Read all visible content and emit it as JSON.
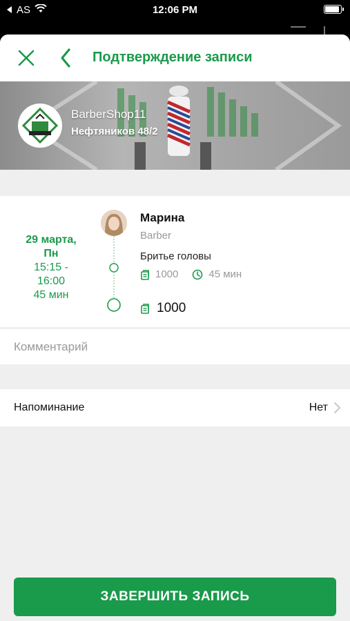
{
  "status_bar": {
    "carrier": "AS",
    "time": "12:06 PM"
  },
  "header": {
    "title": "Подтверждение записи",
    "close_icon": "close-icon",
    "back_icon": "chevron-left-icon"
  },
  "salon": {
    "name": "BarberShop11",
    "address": "Нефтяников 48/2"
  },
  "booking": {
    "date": "29 марта, Пн",
    "time": "15:15 - 16:00",
    "duration": "45 мин",
    "master_name": "Марина",
    "master_role": "Barber",
    "service_name": "Бритье головы",
    "service_price": "1000",
    "service_duration": "45 мин",
    "total": "1000"
  },
  "comment": {
    "placeholder": "Комментарий",
    "value": ""
  },
  "reminder": {
    "label": "Напоминание",
    "value": "Нет"
  },
  "cta": {
    "label": "ЗАВЕРШИТЬ ЗАПИСЬ"
  },
  "colors": {
    "accent": "#1a9a4b",
    "background": "#efefef",
    "muted_text": "#999999"
  }
}
